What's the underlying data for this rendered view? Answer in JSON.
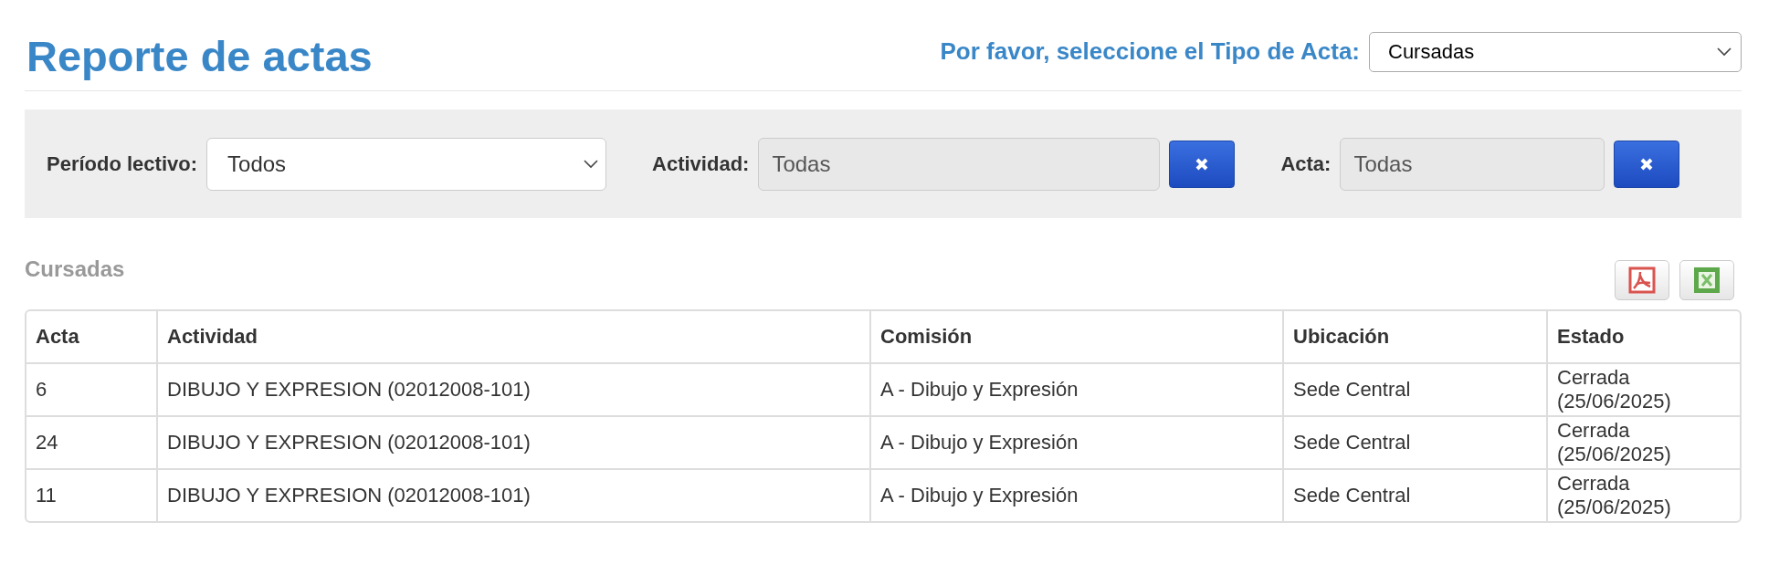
{
  "title": "Reporte de actas",
  "tipo_acta": {
    "label": "Por favor, seleccione el Tipo de Acta:",
    "value": "Cursadas"
  },
  "filters": [
    {
      "kind": "select",
      "label": "Período lectivo:",
      "value": "Todos"
    },
    {
      "kind": "lookup",
      "label": "Actividad:",
      "value": "Todas"
    },
    {
      "kind": "lookup",
      "label": "Acta:",
      "value": "Todas"
    }
  ],
  "section_title": "Cursadas",
  "table": {
    "columns": [
      "Acta",
      "Actividad",
      "Comisión",
      "Ubicación",
      "Estado"
    ],
    "rows": [
      [
        "6",
        "DIBUJO Y EXPRESION (02012008-101)",
        "A - Dibujo y Expresión",
        "Sede Central",
        "Cerrada (25/06/2025)"
      ],
      [
        "24",
        "DIBUJO Y EXPRESION (02012008-101)",
        "A - Dibujo y Expresión",
        "Sede Central",
        "Cerrada (25/06/2025)"
      ],
      [
        "11",
        "DIBUJO Y EXPRESION (02012008-101)",
        "A - Dibujo y Expresión",
        "Sede Central",
        "Cerrada (25/06/2025)"
      ]
    ]
  }
}
